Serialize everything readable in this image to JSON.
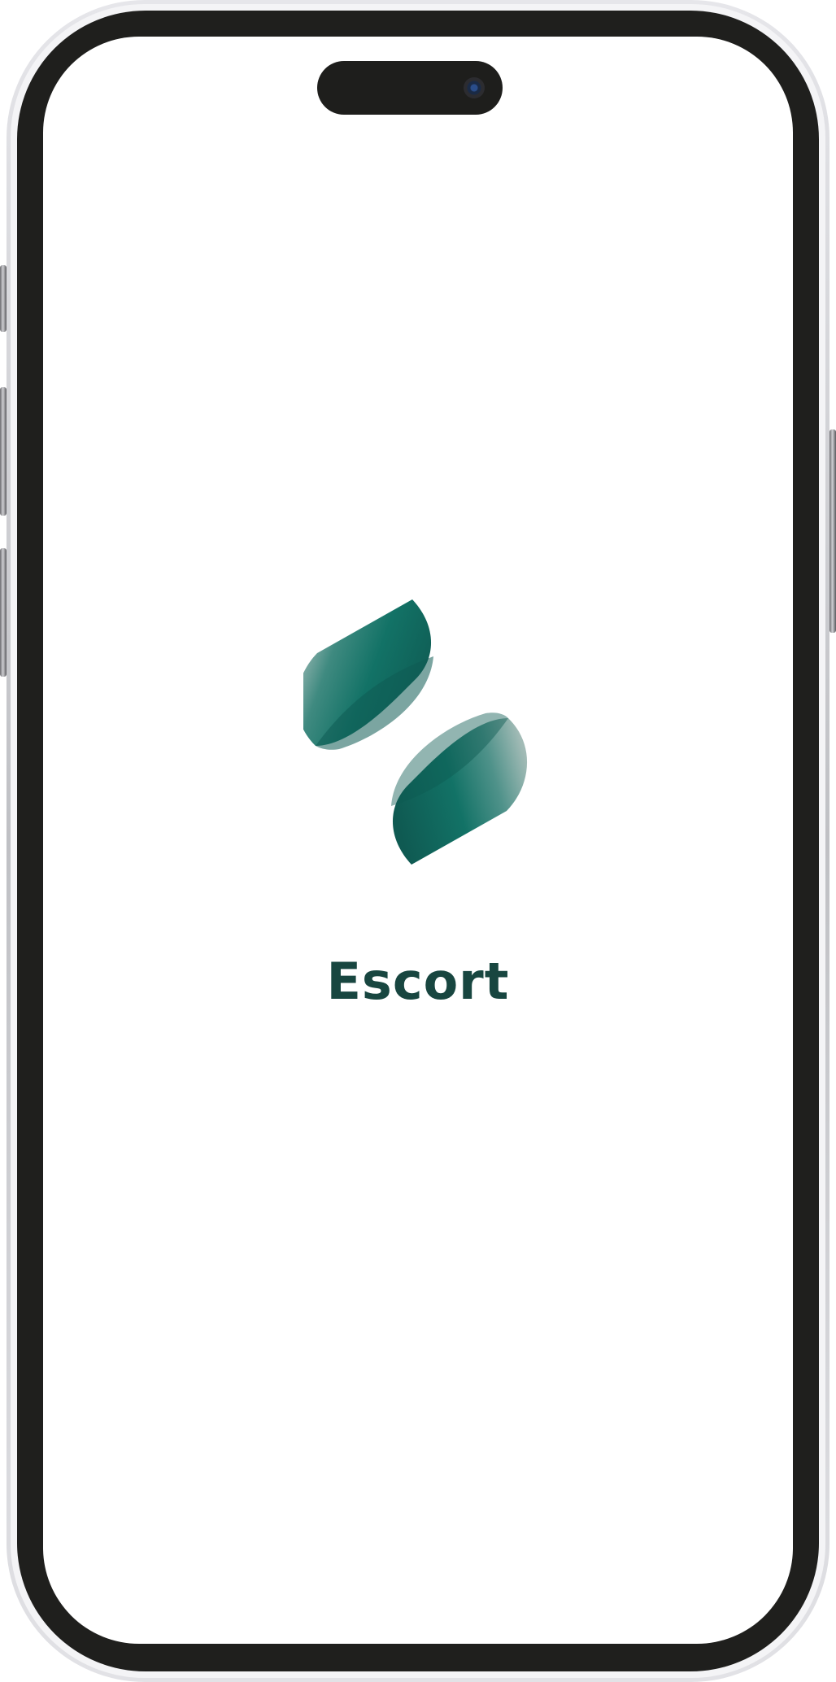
{
  "app": {
    "name": "Escort"
  },
  "logo": {
    "icon": "brand-s-logo-icon",
    "colors": {
      "primary": "#127266",
      "dark": "#0f5a52",
      "light": "#9bb7b2"
    }
  },
  "text_color": "#184640"
}
